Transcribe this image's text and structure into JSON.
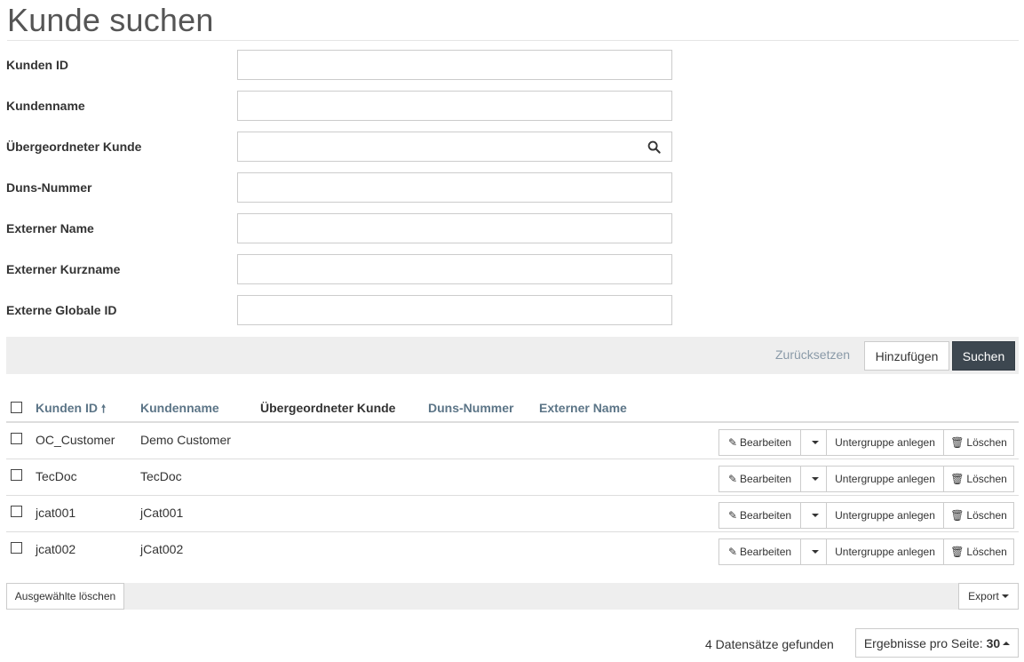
{
  "page": {
    "title": "Kunde suchen"
  },
  "form": {
    "fields": [
      {
        "label": "Kunden ID",
        "value": ""
      },
      {
        "label": "Kundenname",
        "value": ""
      },
      {
        "label": "Übergeordneter Kunde",
        "value": "",
        "addon_icon": "search-icon"
      },
      {
        "label": "Duns-Nummer",
        "value": ""
      },
      {
        "label": "Externer Name",
        "value": ""
      },
      {
        "label": "Externer Kurzname",
        "value": ""
      },
      {
        "label": "Externe Globale ID",
        "value": ""
      }
    ]
  },
  "actions": {
    "reset_label": "Zurücksetzen",
    "add_label": "Hinzufügen",
    "search_label": "Suchen"
  },
  "table": {
    "columns": [
      {
        "label": "Kunden ID",
        "sortable": true,
        "sorted": "asc"
      },
      {
        "label": "Kundenname",
        "sortable": true
      },
      {
        "label": "Übergeordneter Kunde",
        "sortable": false
      },
      {
        "label": "Duns-Nummer",
        "sortable": true
      },
      {
        "label": "Externer Name",
        "sortable": true
      }
    ],
    "sort_arrow": "🠕",
    "rows": [
      {
        "id": "OC_Customer",
        "name": "Demo Customer"
      },
      {
        "id": "TecDoc",
        "name": "TecDoc"
      },
      {
        "id": "jcat001",
        "name": "jCat001"
      },
      {
        "id": "jcat002",
        "name": "jCat002"
      }
    ],
    "row_actions": {
      "edit_label": "Bearbeiten",
      "subgroup_label": "Untergruppe anlegen",
      "delete_label": "Löschen"
    }
  },
  "footer": {
    "delete_selected_label": "Ausgewählte löschen",
    "export_label": "Export",
    "record_count": "4 Datensätze gefunden",
    "per_page_label": "Ergebnisse pro Seite:",
    "per_page_value": "30"
  },
  "colors": {
    "header_link": "#5c7587",
    "primary_button": "#3d4750",
    "bar_background": "#eeeeee"
  }
}
